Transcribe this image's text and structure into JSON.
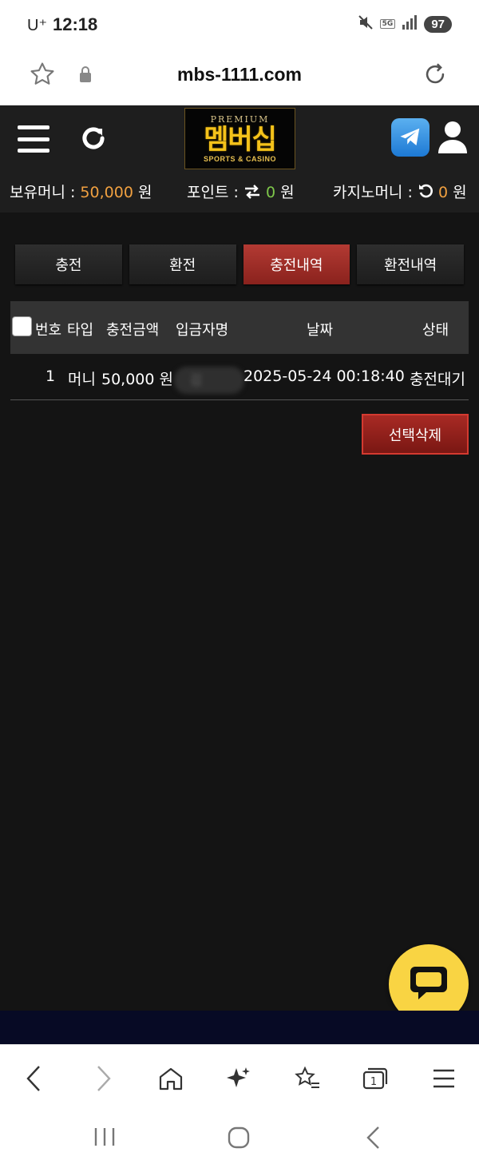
{
  "status_bar": {
    "carrier": "U⁺",
    "time": "12:18",
    "network": "5G",
    "battery": "97"
  },
  "browser": {
    "url": "mbs-1111.com"
  },
  "header": {
    "logo_premium": "PREMIUM",
    "logo_main": "멤버십",
    "logo_sub": "SPORTS & CASINO"
  },
  "balances": {
    "money_label": "보유머니 :",
    "money_value": "50,000",
    "money_unit": "원",
    "point_label": "포인트 :",
    "point_value": "0",
    "point_unit": "원",
    "casino_label": "카지노머니 :",
    "casino_value": "0",
    "casino_unit": "원"
  },
  "tabs": [
    {
      "label": "충전",
      "active": false
    },
    {
      "label": "환전",
      "active": false
    },
    {
      "label": "충전내역",
      "active": true
    },
    {
      "label": "환전내역",
      "active": false
    }
  ],
  "table": {
    "headers": {
      "number": "번호",
      "type": "타입",
      "amount": "충전금액",
      "depositor": "입금자명",
      "date": "날짜",
      "status": "상태"
    },
    "rows": [
      {
        "number": "1",
        "type": "머니",
        "amount": "50,000 원",
        "depositor": "김",
        "date": "2025-05-24 00:18:40",
        "status": "충전대기"
      }
    ]
  },
  "actions": {
    "delete_selected": "선택삭제"
  },
  "colors": {
    "accent_orange": "#f0a040",
    "accent_green": "#7ec74a",
    "active_tab": "#a82a24",
    "chat_yellow": "#f9d443"
  }
}
